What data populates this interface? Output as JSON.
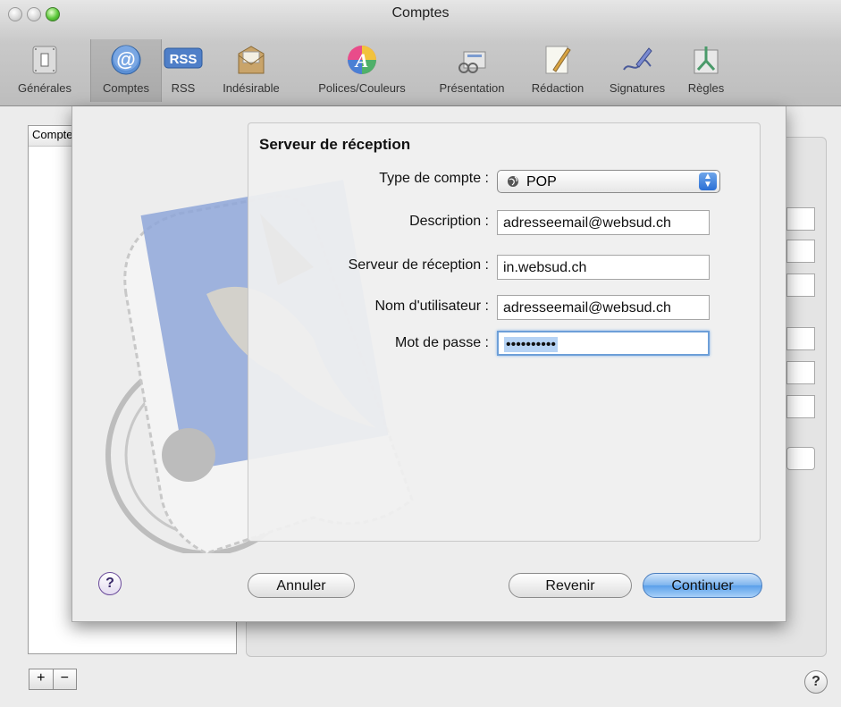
{
  "window": {
    "title": "Comptes"
  },
  "toolbar": {
    "items": [
      {
        "label": "Générales",
        "icon": "general-switch-icon"
      },
      {
        "label": "Comptes",
        "icon": "at-sign-icon",
        "selected": true
      },
      {
        "label": "RSS",
        "icon": "rss-icon"
      },
      {
        "label": "Indésirable",
        "icon": "junk-mail-icon"
      },
      {
        "label": "Polices/Couleurs",
        "icon": "fonts-colors-icon"
      },
      {
        "label": "Présentation",
        "icon": "viewing-icon"
      },
      {
        "label": "Rédaction",
        "icon": "composing-pencil-icon"
      },
      {
        "label": "Signatures",
        "icon": "signature-pen-icon"
      },
      {
        "label": "Règles",
        "icon": "rules-icon"
      }
    ]
  },
  "accounts": {
    "header": "Comptes"
  },
  "sheet": {
    "title": "Serveur de réception",
    "fields": {
      "account_type": {
        "label": "Type de compte :",
        "value": "POP"
      },
      "description": {
        "label": "Description :",
        "value": "adresseemail@websud.ch"
      },
      "incoming_server": {
        "label": "Serveur de réception :",
        "value": "in.websud.ch"
      },
      "username": {
        "label": "Nom d'utilisateur :",
        "value": "adresseemail@websud.ch"
      },
      "password": {
        "label": "Mot de passe :",
        "value": "••••••••••"
      }
    },
    "buttons": {
      "cancel": "Annuler",
      "back": "Revenir",
      "continue": "Continuer"
    },
    "help": "?"
  },
  "footer": {
    "add": "+",
    "remove": "−",
    "help": "?"
  },
  "colors": {
    "default_button": "#5aa0ea",
    "focus_ring": "#6d9fd8",
    "selection": "#b6d3f5"
  }
}
